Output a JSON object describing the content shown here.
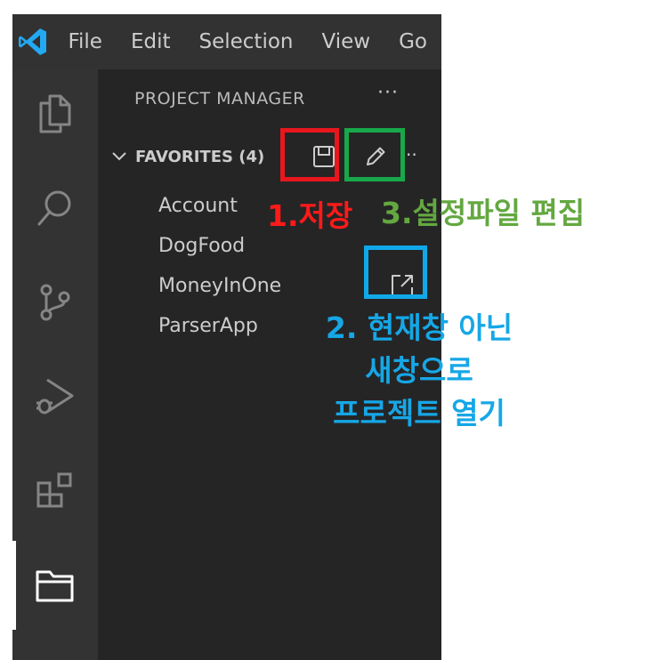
{
  "menu": [
    "File",
    "Edit",
    "Selection",
    "View",
    "Go"
  ],
  "sidebar": {
    "title": "PROJECT MANAGER",
    "more": "···",
    "section": {
      "label": "FAVORITES (4)",
      "more": "··"
    },
    "projects": [
      "Account",
      "DogFood",
      "MoneyInOne",
      "ParserApp"
    ]
  },
  "annotations": {
    "save": "1.저장",
    "edit": "3.설정파일 편집",
    "open_new_window": [
      "2. 현재창 아닌",
      "새창으로",
      "프로젝트 열기"
    ]
  },
  "colors": {
    "save_box": "#e8171d",
    "edit_box": "#18a84a",
    "open_box": "#11a8e8",
    "vscode_blue": "#23a9f2"
  },
  "icons": {
    "activity": [
      "explorer-icon",
      "search-icon",
      "source-control-icon",
      "run-debug-icon",
      "extensions-icon",
      "project-manager-icon"
    ],
    "section": [
      "save-icon",
      "edit-icon"
    ],
    "row": "open-new-window-icon"
  }
}
